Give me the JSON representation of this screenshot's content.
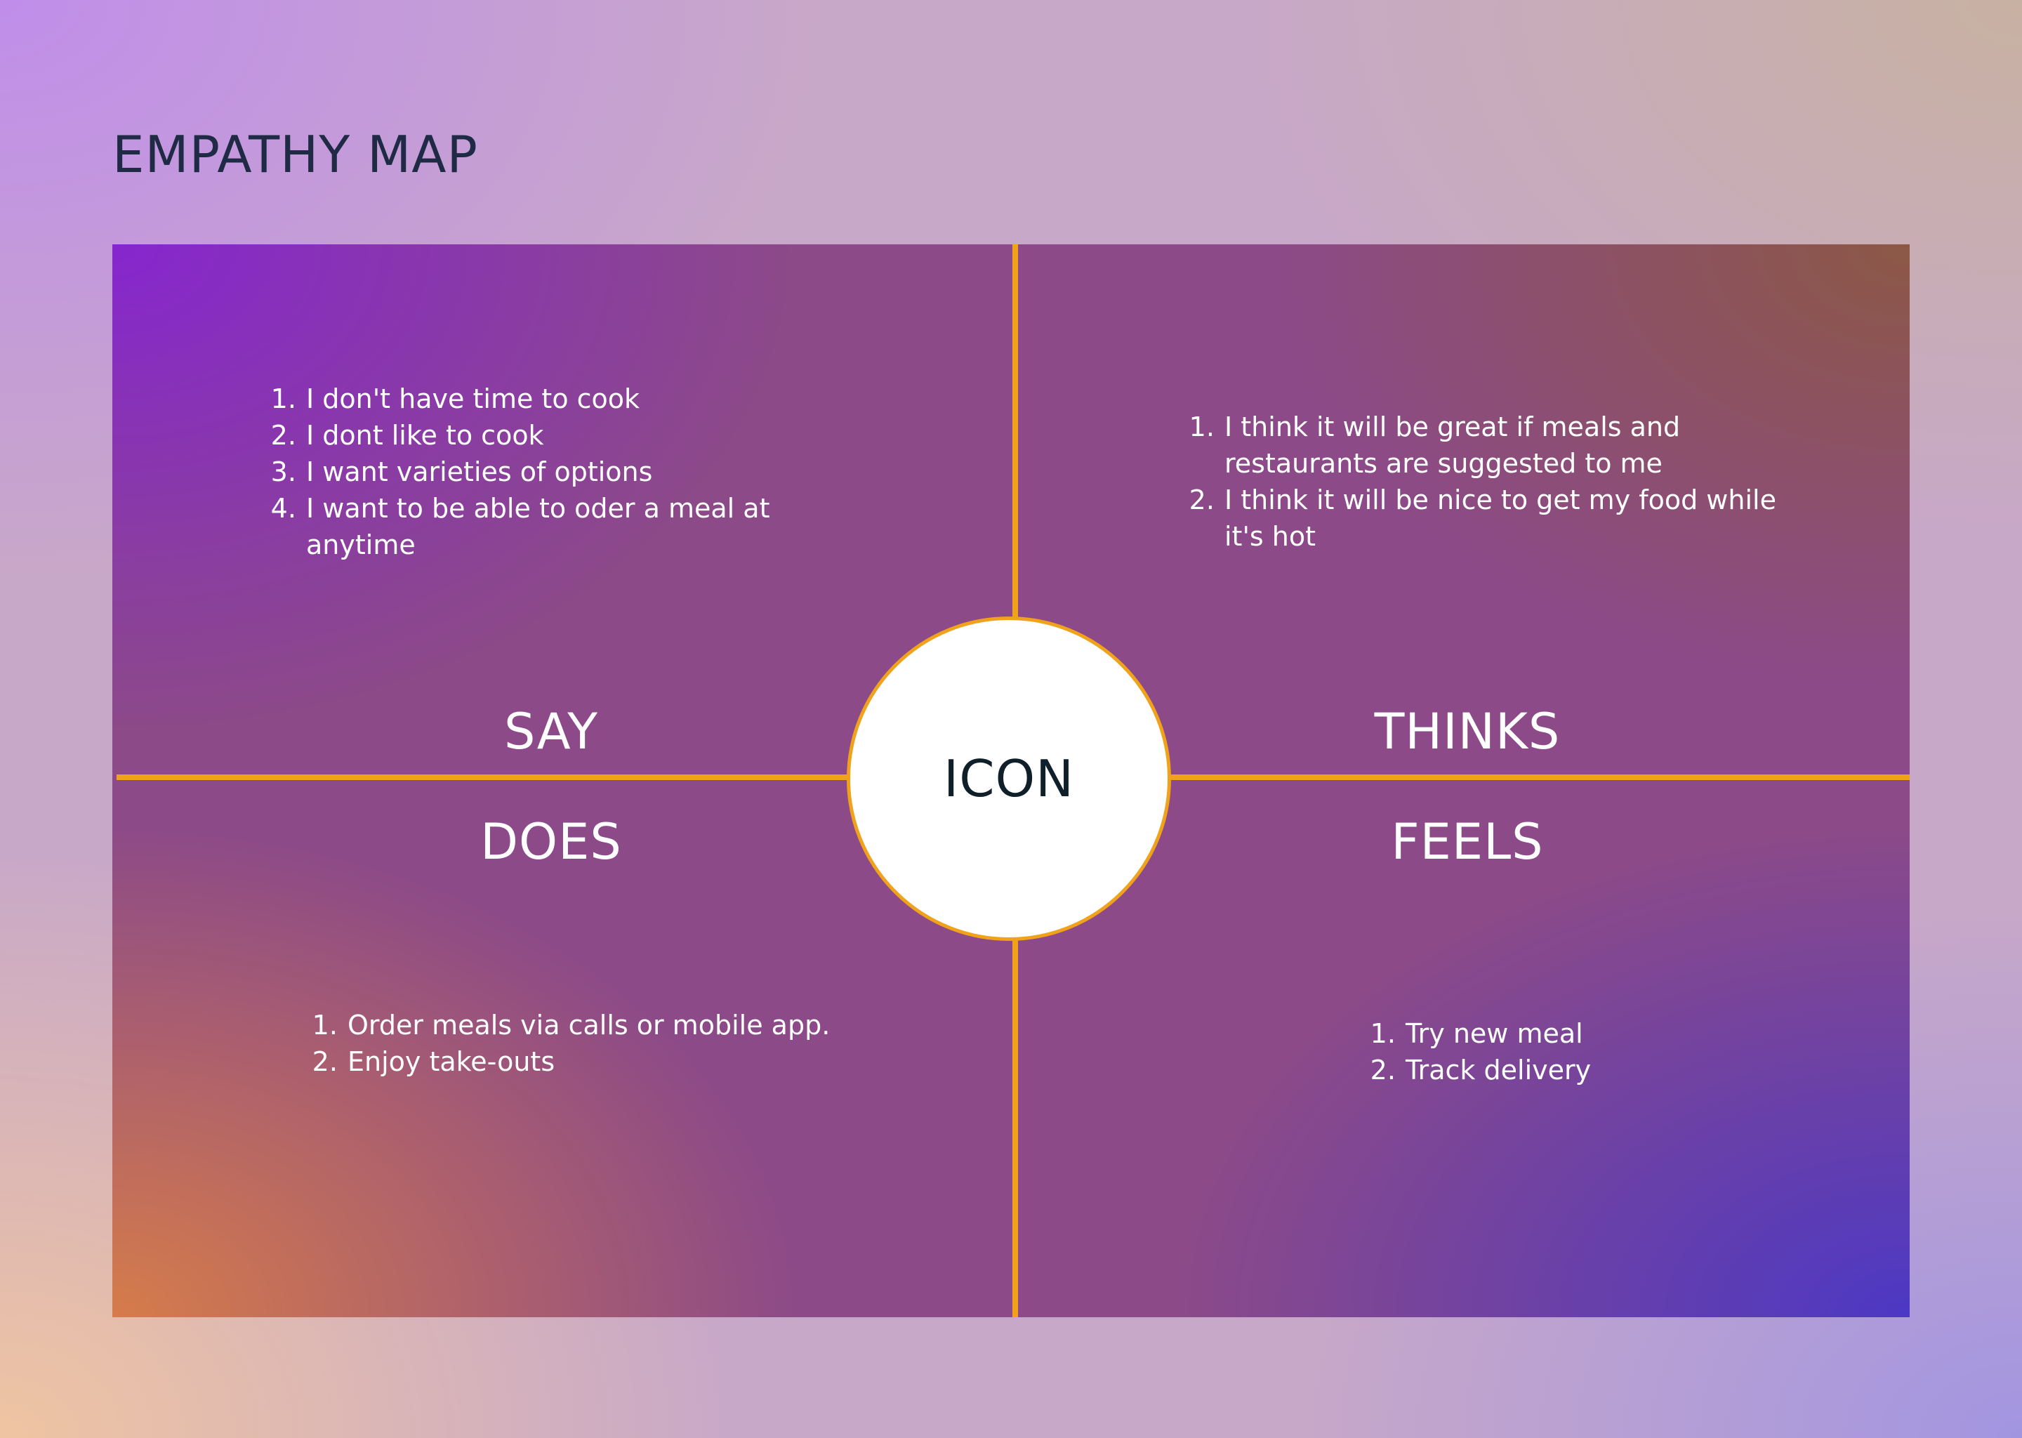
{
  "page": {
    "title": "EMPATHY MAP"
  },
  "center": {
    "label": "ICON"
  },
  "quadrants": {
    "says": {
      "title": "SAY",
      "items": [
        "I don't have time to cook",
        "I dont like to cook",
        "I want varieties of options",
        "I want to be able to oder a meal at anytime"
      ]
    },
    "thinks": {
      "title": "THINKS",
      "items": [
        "I think it will be great if meals and restaurants are suggested to me",
        "I think it will be nice to get my food while it's hot"
      ]
    },
    "does": {
      "title": "DOES",
      "items": [
        "Order meals via calls or mobile app.",
        "Enjoy take-outs"
      ]
    },
    "feels": {
      "title": "FEELS",
      "items": [
        "Try new meal",
        "Track delivery"
      ]
    }
  },
  "colors": {
    "divider": "#f0a21a",
    "title_text": "#1f2a44",
    "quadrant_text": "#ffffff",
    "center_fill": "#ffffff",
    "center_text": "#10202a"
  }
}
